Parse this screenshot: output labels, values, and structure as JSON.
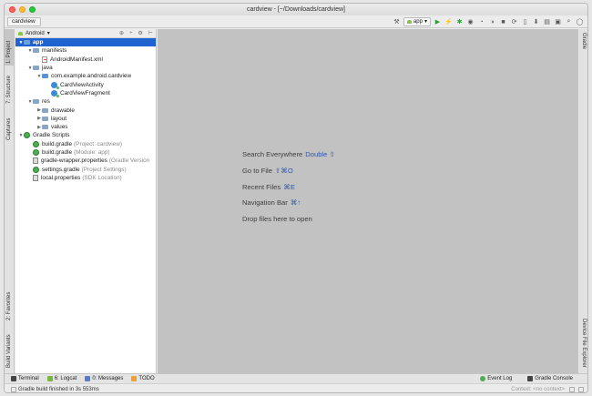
{
  "window": {
    "title": "cardview - [~/Downloads/cardview]"
  },
  "navbar": {
    "breadcrumb": "cardview"
  },
  "toolbar": {
    "run_config": "app"
  },
  "left_tabs": {
    "project": "1: Project",
    "structure": "7: Structure",
    "captures": "Captures",
    "favorites": "2: Favorites",
    "build_variants": "Build Variants"
  },
  "right_tabs": {
    "gradle": "Gradle",
    "device_file_explorer": "Device File Explorer"
  },
  "project_panel": {
    "view_selector": "Android",
    "tree": [
      {
        "label": "app",
        "extra": "",
        "depth": 0,
        "icon": "module-folder-icon",
        "expanded": true,
        "selected": true
      },
      {
        "label": "manifests",
        "extra": "",
        "depth": 1,
        "icon": "folder-icon",
        "expanded": true
      },
      {
        "label": "AndroidManifest.xml",
        "extra": "",
        "depth": 2,
        "icon": "xml-file-icon",
        "leaf": true
      },
      {
        "label": "java",
        "extra": "",
        "depth": 1,
        "icon": "folder-icon",
        "expanded": true
      },
      {
        "label": "com.example.android.cardview",
        "extra": "",
        "depth": 2,
        "icon": "package-icon",
        "expanded": true
      },
      {
        "label": "CardViewActivity",
        "extra": "",
        "depth": 3,
        "icon": "class-icon",
        "leaf": true
      },
      {
        "label": "CardViewFragment",
        "extra": "",
        "depth": 3,
        "icon": "class-icon",
        "leaf": true
      },
      {
        "label": "res",
        "extra": "",
        "depth": 1,
        "icon": "folder-icon",
        "expanded": true
      },
      {
        "label": "drawable",
        "extra": "",
        "depth": 2,
        "icon": "folder-icon",
        "expanded": false
      },
      {
        "label": "layout",
        "extra": "",
        "depth": 2,
        "icon": "folder-icon",
        "expanded": false
      },
      {
        "label": "values",
        "extra": "",
        "depth": 2,
        "icon": "folder-icon",
        "expanded": false
      },
      {
        "label": "Gradle Scripts",
        "extra": "",
        "depth": 0,
        "icon": "gradle-icon",
        "expanded": true
      },
      {
        "label": "build.gradle",
        "extra": "(Project: cardview)",
        "depth": 1,
        "icon": "gradle-icon",
        "leaf": true
      },
      {
        "label": "build.gradle",
        "extra": "(Module: app)",
        "depth": 1,
        "icon": "gradle-icon",
        "leaf": true
      },
      {
        "label": "gradle-wrapper.properties",
        "extra": "(Gradle Version",
        "depth": 1,
        "icon": "properties-file-icon",
        "leaf": true
      },
      {
        "label": "settings.gradle",
        "extra": "(Project Settings)",
        "depth": 1,
        "icon": "gradle-icon",
        "leaf": true
      },
      {
        "label": "local.properties",
        "extra": "(SDK Location)",
        "depth": 1,
        "icon": "properties-file-icon",
        "leaf": true
      }
    ]
  },
  "editor_hints": [
    {
      "text": "Search Everywhere",
      "shortcut": "Double ⇧"
    },
    {
      "text": "Go to File",
      "shortcut": "⇧⌘O"
    },
    {
      "text": "Recent Files",
      "shortcut": "⌘E"
    },
    {
      "text": "Navigation Bar",
      "shortcut": "⌘↑"
    },
    {
      "text": "Drop files here to open",
      "shortcut": ""
    }
  ],
  "bottom_tabs": {
    "terminal": "Terminal",
    "logcat": "6: Logcat",
    "messages": "0: Messages",
    "todo": "TODO",
    "event_log": "Event Log",
    "gradle_console": "Gradle Console"
  },
  "status": {
    "message": "Gradle build finished in 3s 553ms",
    "context": "Context: <no context>"
  }
}
